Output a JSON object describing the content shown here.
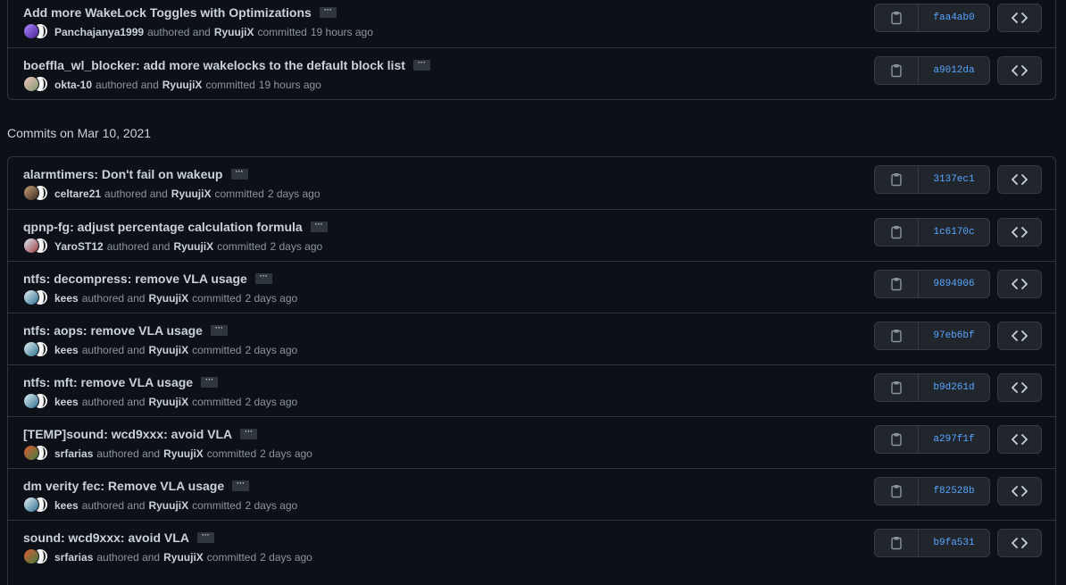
{
  "groups": [
    {
      "heading": "",
      "commits": [
        {
          "message": "Add more WakeLock Toggles with Optimizations",
          "author": "Panchajanya1999",
          "authored_word": "authored and",
          "committer": "RyuujiX",
          "committed_word": "committed",
          "time": "19 hours ago",
          "sha": "faa4ab0",
          "avatar_colors": [
            "#a78bfa",
            "#4c1d95"
          ]
        },
        {
          "message": "boeffla_wl_blocker: add more wakelocks to the default block list",
          "author": "okta-10",
          "authored_word": "authored and",
          "committer": "RyuujiX",
          "committed_word": "committed",
          "time": "19 hours ago",
          "sha": "a9012da",
          "avatar_colors": [
            "#f4c2c2",
            "#7c9a6b"
          ]
        }
      ]
    },
    {
      "heading": "Commits on Mar 10, 2021",
      "commits": [
        {
          "message": "alarmtimers: Don't fail on wakeup",
          "author": "celtare21",
          "authored_word": "authored and",
          "committer": "RyuujiX",
          "committed_word": "committed",
          "time": "2 days ago",
          "sha": "3137ec1",
          "avatar_colors": [
            "#c2a079",
            "#3b2a1e"
          ]
        },
        {
          "message": "qpnp-fg: adjust percentage calculation formula",
          "author": "YaroST12",
          "authored_word": "authored and",
          "committer": "RyuujiX",
          "committed_word": "committed",
          "time": "2 days ago",
          "sha": "1c6170c",
          "avatar_colors": [
            "#dbeafe",
            "#9d3b3b"
          ]
        },
        {
          "message": "ntfs: decompress: remove VLA usage",
          "author": "kees",
          "authored_word": "authored and",
          "committer": "RyuujiX",
          "committed_word": "committed",
          "time": "2 days ago",
          "sha": "9894906",
          "avatar_colors": [
            "#e5f0f5",
            "#2b6f8e"
          ]
        },
        {
          "message": "ntfs: aops: remove VLA usage",
          "author": "kees",
          "authored_word": "authored and",
          "committer": "RyuujiX",
          "committed_word": "committed",
          "time": "2 days ago",
          "sha": "97eb6bf",
          "avatar_colors": [
            "#e5f0f5",
            "#2b6f8e"
          ]
        },
        {
          "message": "ntfs: mft: remove VLA usage",
          "author": "kees",
          "authored_word": "authored and",
          "committer": "RyuujiX",
          "committed_word": "committed",
          "time": "2 days ago",
          "sha": "b9d261d",
          "avatar_colors": [
            "#e5f0f5",
            "#2b6f8e"
          ]
        },
        {
          "message": "[TEMP]sound: wcd9xxx: avoid VLA",
          "author": "srfarias",
          "authored_word": "authored and",
          "committer": "RyuujiX",
          "committed_word": "committed",
          "time": "2 days ago",
          "sha": "a297f1f",
          "avatar_colors": [
            "#e05a3a",
            "#3f7d3a"
          ]
        },
        {
          "message": "dm verity fec: Remove VLA usage",
          "author": "kees",
          "authored_word": "authored and",
          "committer": "RyuujiX",
          "committed_word": "committed",
          "time": "2 days ago",
          "sha": "f82528b",
          "avatar_colors": [
            "#e5f0f5",
            "#2b6f8e"
          ]
        },
        {
          "message": "sound: wcd9xxx: avoid VLA",
          "author": "srfarias",
          "authored_word": "authored and",
          "committer": "RyuujiX",
          "committed_word": "committed",
          "time": "2 days ago",
          "sha": "b9fa531",
          "avatar_colors": [
            "#e05a3a",
            "#3f7d3a"
          ]
        }
      ]
    }
  ],
  "ellipsis_label": "···",
  "icons": {
    "copy": "clipboard-icon",
    "browse": "code-brackets-icon"
  },
  "colors": {
    "background": "#0d1117",
    "border": "#30363d",
    "link": "#58a6ff",
    "muted": "#8b949e"
  }
}
